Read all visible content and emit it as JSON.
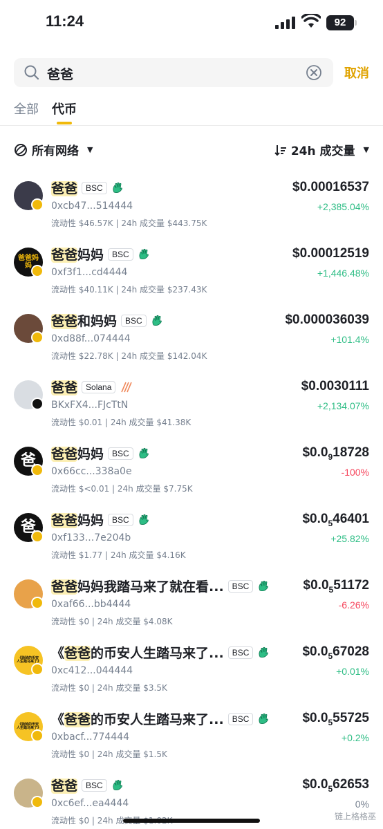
{
  "status_bar": {
    "time": "11:24",
    "battery": "92"
  },
  "search": {
    "query": "爸爸",
    "cancel_label": "取消"
  },
  "tabs": [
    {
      "label": "全部"
    },
    {
      "label": "代币"
    }
  ],
  "filters": {
    "network_label": "所有网络",
    "sort_label": "24h 成交量"
  },
  "tokens": [
    {
      "name_hl": "爸爸",
      "name_rest": "",
      "chain": "BSC",
      "address": "0xcb47...514444",
      "meta": "流动性 $46.57K | 24h 成交量 $443.75K",
      "price": "$0.00016537",
      "price_sub": "",
      "price_tail": "",
      "change": "+2,385.04%"
    },
    {
      "name_hl": "爸爸",
      "name_rest": "妈妈",
      "chain": "BSC",
      "address": "0xf3f1...cd4444",
      "meta": "流动性 $40.11K | 24h 成交量 $237.43K",
      "price": "$0.00012519",
      "price_sub": "",
      "price_tail": "",
      "change": "+1,446.48%"
    },
    {
      "name_hl": "爸爸",
      "name_rest": "和妈妈",
      "chain": "BSC",
      "address": "0xd88f...074444",
      "meta": "流动性 $22.78K | 24h 成交量 $142.04K",
      "price": "$0.000036039",
      "price_sub": "",
      "price_tail": "",
      "change": "+101.4%"
    },
    {
      "name_hl": "爸爸",
      "name_rest": "",
      "chain": "Solana",
      "address": "BKxFX4...FJcTtN",
      "meta": "流动性 $0.01 | 24h 成交量 $41.38K",
      "price": "$0.0030111",
      "price_sub": "",
      "price_tail": "",
      "change": "+2,134.07%"
    },
    {
      "name_hl": "爸爸",
      "name_rest": "妈妈",
      "chain": "BSC",
      "address": "0x66cc...338a0e",
      "meta": "流动性 $<0.01 | 24h 成交量 $7.75K",
      "price": "$0.0",
      "price_sub": "9",
      "price_tail": "18728",
      "change": "-100%"
    },
    {
      "name_hl": "爸爸",
      "name_rest": "妈妈",
      "chain": "BSC",
      "address": "0xf133...7e204b",
      "meta": "流动性 $1.77 | 24h 成交量 $4.16K",
      "price": "$0.0",
      "price_sub": "5",
      "price_tail": "46401",
      "change": "+25.82%"
    },
    {
      "name_hl": "爸爸",
      "name_rest": "妈妈我踏马来了就在看...",
      "chain": "BSC",
      "address": "0xaf66...bb4444",
      "meta": "流动性 $0 | 24h 成交量 $4.08K",
      "price": "$0.0",
      "price_sub": "5",
      "price_tail": "51172",
      "change": "-6.26%"
    },
    {
      "name_pre": "《",
      "name_hl": "爸爸",
      "name_rest": "的币安人生踏马来了...",
      "chain": "BSC",
      "address": "0xc412...044444",
      "meta": "流动性 $0 | 24h 成交量 $3.5K",
      "price": "$0.0",
      "price_sub": "5",
      "price_tail": "67028",
      "change": "+0.01%"
    },
    {
      "name_pre": "《",
      "name_hl": "爸爸",
      "name_rest": "的币安人生踏马来了...",
      "chain": "BSC",
      "address": "0xbacf...774444",
      "meta": "流动性 $0 | 24h 成交量 $1.5K",
      "price": "$0.0",
      "price_sub": "5",
      "price_tail": "55725",
      "change": "+0.2%"
    },
    {
      "name_hl": "爸爸",
      "name_rest": "",
      "chain": "BSC",
      "address": "0xc6ef...ea4444",
      "meta": "流动性 $0 | 24h 成交量 $1.02K",
      "price": "$0.0",
      "price_sub": "5",
      "price_tail": "62653",
      "change": "0%"
    }
  ],
  "avatar_texts": {
    "row2": "爸爸妈妈",
    "row5": "爸",
    "row6": "爸",
    "row8": "《骑骑的币安人生踏马来了》",
    "row9": "《骑骑的币安人生踏马来了》"
  },
  "watermark": "链上格格巫",
  "colors": {
    "accent": "#f0b90b",
    "up": "#2ebd85",
    "down": "#f6465d"
  }
}
